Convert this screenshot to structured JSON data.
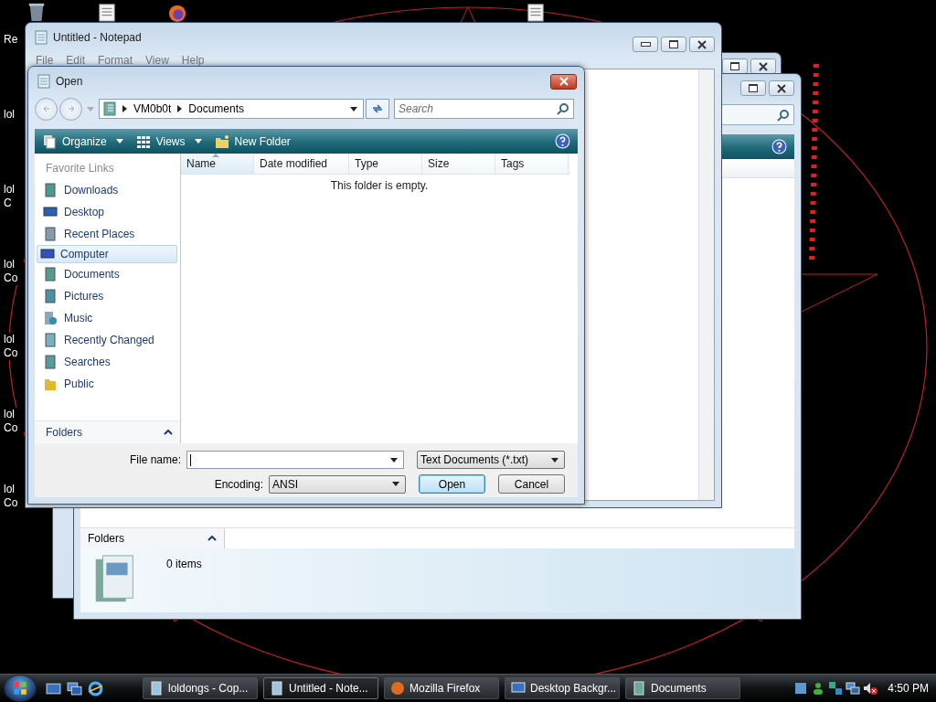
{
  "desktop_icons": [
    {
      "label": "Re"
    },
    {
      "label": "lol"
    },
    {
      "label": "lol C"
    },
    {
      "label": "lol Co"
    },
    {
      "label": "lol Co"
    },
    {
      "label": "lol Co"
    },
    {
      "label": "lol Co"
    }
  ],
  "explorer": {
    "folders_label": "Folders",
    "status": "0 items"
  },
  "notepad": {
    "title": "Untitled - Notepad",
    "menu": [
      "File",
      "Edit",
      "Format",
      "View",
      "Help"
    ]
  },
  "open_dialog": {
    "title": "Open",
    "path": [
      "VM0b0t",
      "Documents"
    ],
    "search_placeholder": "Search",
    "toolbar": [
      {
        "label": "Organize",
        "kind": "organize"
      },
      {
        "label": "Views",
        "kind": "views"
      },
      {
        "label": "New Folder",
        "kind": "new_folder"
      }
    ],
    "sidebar": {
      "heading": "Favorite Links",
      "folders_label": "Folders",
      "links": [
        {
          "label": "Downloads",
          "kind": "downloads",
          "selected": false
        },
        {
          "label": "Desktop",
          "kind": "desktop",
          "selected": false
        },
        {
          "label": "Recent Places",
          "kind": "recent",
          "selected": false
        },
        {
          "label": "Computer",
          "kind": "computer",
          "selected": true
        },
        {
          "label": "Documents",
          "kind": "documents",
          "selected": false
        },
        {
          "label": "Pictures",
          "kind": "pictures",
          "selected": false
        },
        {
          "label": "Music",
          "kind": "music",
          "selected": false
        },
        {
          "label": "Recently Changed",
          "kind": "changed",
          "selected": false
        },
        {
          "label": "Searches",
          "kind": "searches",
          "selected": false
        },
        {
          "label": "Public",
          "kind": "public",
          "selected": false
        }
      ]
    },
    "columns": [
      {
        "label": "Name",
        "sorted": true
      },
      {
        "label": "Date modified",
        "sorted": false
      },
      {
        "label": "Type",
        "sorted": false
      },
      {
        "label": "Size",
        "sorted": false
      },
      {
        "label": "Tags",
        "sorted": false
      }
    ],
    "empty_message": "This folder is empty.",
    "file_name_label": "File name:",
    "file_type": "Text Documents (*.txt)",
    "encoding": {
      "label": "Encoding:",
      "value": "ANSI"
    },
    "buttons": [
      {
        "label": "Open",
        "default": true
      },
      {
        "label": "Cancel",
        "default": false
      }
    ]
  },
  "taskbar": {
    "tasks": [
      {
        "label": "loldongs - Cop...",
        "kind": "notepad",
        "selected": false
      },
      {
        "label": "Untitled - Note...",
        "kind": "notepad",
        "selected": true
      },
      {
        "label": "Mozilla Firefox",
        "kind": "firefox",
        "selected": false
      },
      {
        "label": "Desktop Backgr...",
        "kind": "monitor",
        "selected": false
      },
      {
        "label": "Documents",
        "kind": "documents",
        "selected": false
      }
    ],
    "clock": "4:50 PM"
  }
}
